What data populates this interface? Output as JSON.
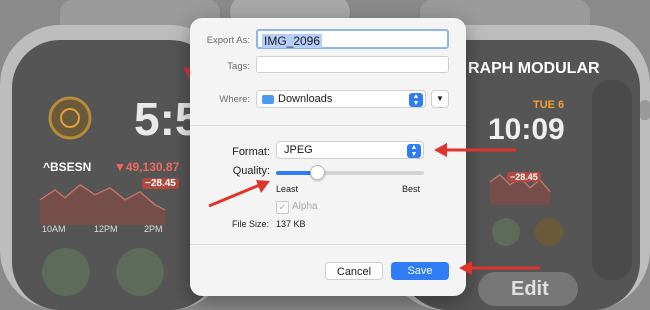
{
  "background": {
    "left_complication_label": "^BSESN",
    "left_complication_value": "▼49,130.87",
    "left_complication_change": "−28.45",
    "left_time_fragment": "5:5",
    "left_axis_labels": [
      "10AM",
      "12PM",
      "2PM"
    ],
    "right_face_title": "RAPH MODULAR",
    "right_date": "TUE 6",
    "right_time": "10:09",
    "right_edit_button": "Edit",
    "right_change_badge": "−28.45"
  },
  "dialog": {
    "export_as_label": "Export As:",
    "export_as_value": "IMG_2096",
    "tags_label": "Tags:",
    "tags_value": "",
    "where_label": "Where:",
    "where_value": "Downloads",
    "format_label": "Format:",
    "format_value": "JPEG",
    "quality_label": "Quality:",
    "quality_level": 0.28,
    "quality_min_label": "Least",
    "quality_max_label": "Best",
    "alpha_label": "Alpha",
    "alpha_checked": true,
    "file_size_label": "File Size:",
    "file_size_value": "137 KB",
    "cancel_label": "Cancel",
    "save_label": "Save"
  },
  "colors": {
    "accent": "#2e7cf6",
    "arrow": "#e0332b",
    "watch_orange": "#f0a030",
    "watch_green": "#39d353",
    "stock_red": "#e8463a"
  }
}
